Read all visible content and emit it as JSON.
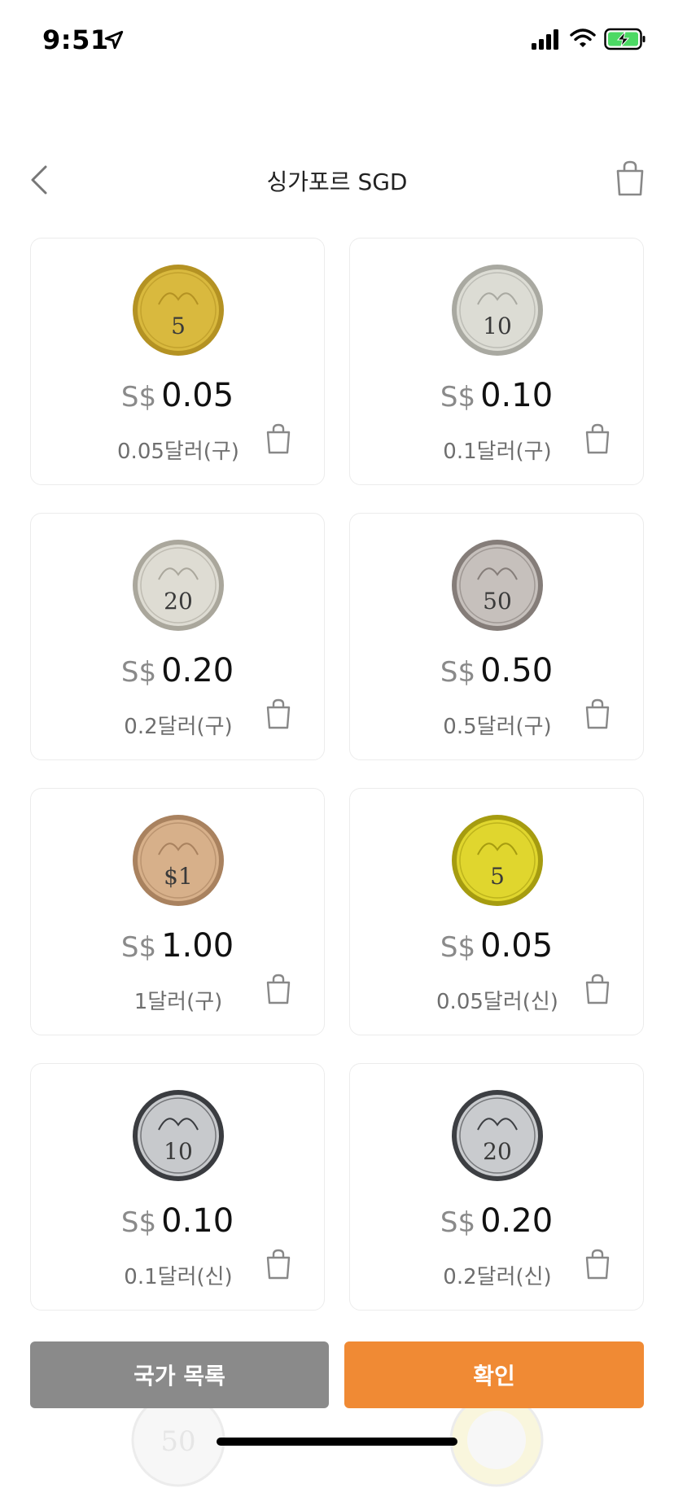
{
  "status_bar": {
    "time": "9:51"
  },
  "header": {
    "title": "싱가포르 SGD"
  },
  "coins": [
    {
      "currency": "S$",
      "value": "0.05",
      "desc": "0.05달러(구)",
      "face": "5",
      "face_color": "#d9b93e",
      "edge_color": "#b49223"
    },
    {
      "currency": "S$",
      "value": "0.10",
      "desc": "0.1달러(구)",
      "face": "10",
      "face_color": "#dcdcd4",
      "edge_color": "#a9a9a1"
    },
    {
      "currency": "S$",
      "value": "0.20",
      "desc": "0.2달러(구)",
      "face": "20",
      "face_color": "#dedcd3",
      "edge_color": "#aaa79c"
    },
    {
      "currency": "S$",
      "value": "0.50",
      "desc": "0.5달러(구)",
      "face": "50",
      "face_color": "#c6c0bc",
      "edge_color": "#857d79"
    },
    {
      "currency": "S$",
      "value": "1.00",
      "desc": "1달러(구)",
      "face": "$1",
      "face_color": "#d7b08a",
      "edge_color": "#a9825f"
    },
    {
      "currency": "S$",
      "value": "0.05",
      "desc": "0.05달러(신)",
      "face": "5",
      "face_color": "#e0d62e",
      "edge_color": "#a69c10"
    },
    {
      "currency": "S$",
      "value": "0.10",
      "desc": "0.1달러(신)",
      "face": "10",
      "face_color": "#c7c9cc",
      "edge_color": "#3a3c40"
    },
    {
      "currency": "S$",
      "value": "0.20",
      "desc": "0.2달러(신)",
      "face": "20",
      "face_color": "#c9cbce",
      "edge_color": "#3d3f43"
    }
  ],
  "bottom_bar": {
    "country_list_label": "국가 목록",
    "confirm_label": "확인"
  },
  "colors": {
    "accent": "#f08a34",
    "secondary_button": "#8a8a8a",
    "card_border": "#ececec"
  },
  "icons": {
    "back": "chevron-left-icon",
    "cart": "shopping-bag-icon",
    "location": "location-arrow-icon"
  }
}
